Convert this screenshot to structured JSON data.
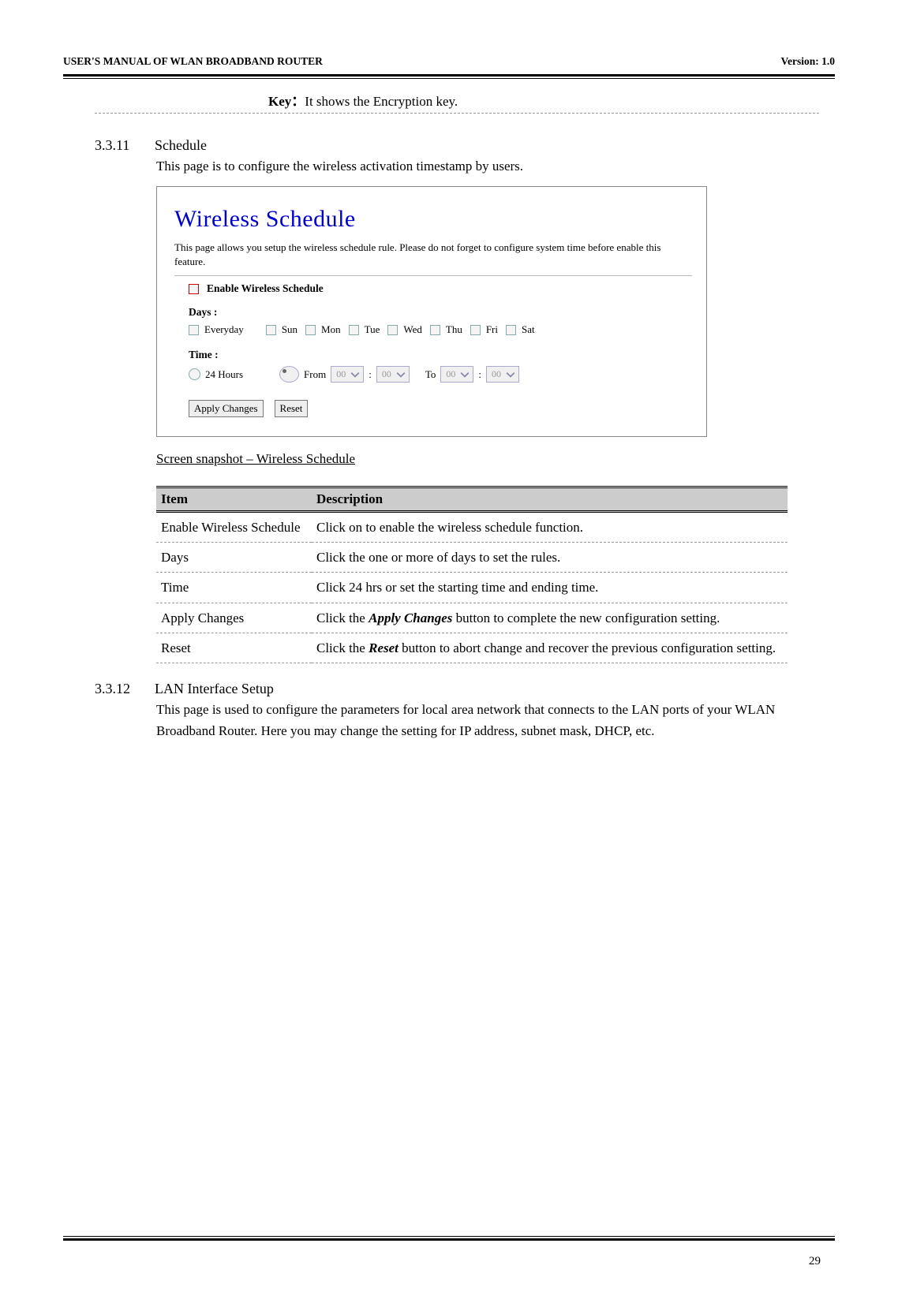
{
  "header": {
    "left": "USER'S MANUAL OF WLAN BROADBAND ROUTER",
    "right": "Version: 1.0"
  },
  "key_row": {
    "bold": "Key：",
    "text": "It shows the Encryption key."
  },
  "s3311": {
    "num": "3.3.11",
    "title": "Schedule",
    "intro": "This page is to configure the wireless activation timestamp by users."
  },
  "screenshot": {
    "title": "Wireless Schedule",
    "desc": "This page allows you setup the wireless schedule rule. Please do not forget to configure system time before enable this feature.",
    "enable_label": "Enable  Wireless Schedule",
    "days_label": "Days :",
    "days": [
      "Everyday",
      "Sun",
      "Mon",
      "Tue",
      "Wed",
      "Thu",
      "Fri",
      "Sat"
    ],
    "time_label": "Time :",
    "time": {
      "opt1": "24 Hours",
      "opt2": "From",
      "from_h": "00",
      "from_m": "00",
      "to_label": "To",
      "to_h": "00",
      "to_m": "00"
    },
    "buttons": {
      "apply": "Apply Changes",
      "reset": "Reset"
    }
  },
  "caption": "Screen snapshot – Wireless Schedule",
  "table": {
    "h1": "Item",
    "h2": "Description",
    "rows": [
      {
        "c1": "Enable Wireless Schedule",
        "c2": "Click on to enable the wireless schedule function."
      },
      {
        "c1": "Days",
        "c2": "Click the one or more of days to set the rules."
      },
      {
        "c1": "Time",
        "c2": "Click 24 hrs or set the starting time and ending time."
      },
      {
        "c1": "Apply Changes",
        "c2_pre": "Click the ",
        "c2_em": "Apply Changes",
        "c2_post": " button to complete the new configuration setting."
      },
      {
        "c1": "Reset",
        "c2_pre": "Click the ",
        "c2_em": "Reset",
        "c2_post": " button to abort change and recover the previous configuration setting."
      }
    ]
  },
  "s3312": {
    "num": "3.3.12",
    "title": "LAN Interface Setup",
    "body": "This page is used to configure the parameters for local area network that connects to the LAN ports of your WLAN Broadband Router. Here you may change the setting for IP address, subnet mask, DHCP, etc."
  },
  "page_number": "29"
}
